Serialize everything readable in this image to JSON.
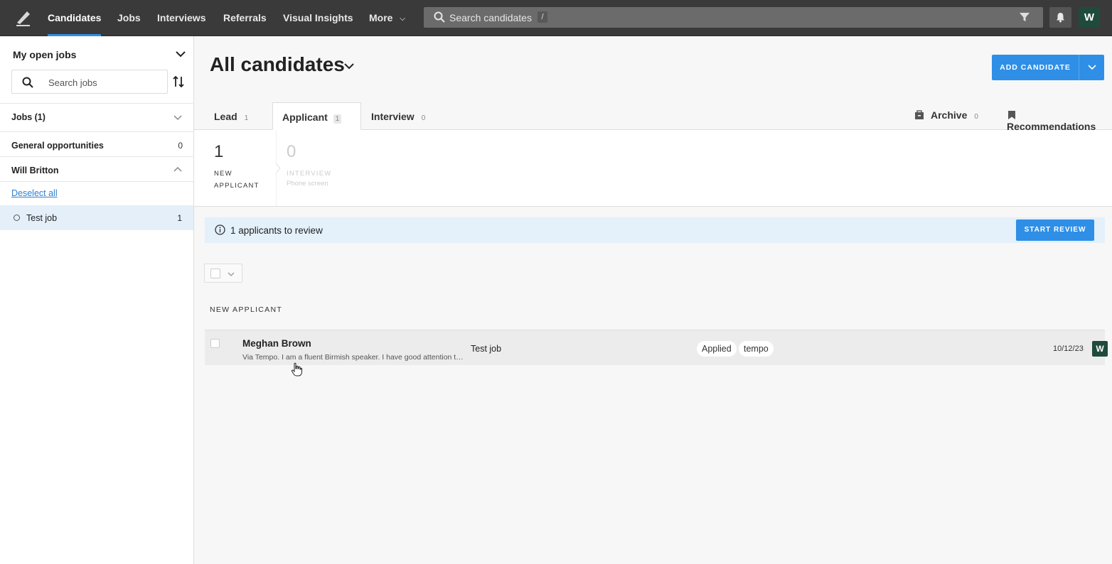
{
  "nav": {
    "items": [
      {
        "label": "Candidates",
        "active": true
      },
      {
        "label": "Jobs"
      },
      {
        "label": "Interviews"
      },
      {
        "label": "Referrals"
      },
      {
        "label": "Visual Insights"
      },
      {
        "label": "More"
      }
    ],
    "search_placeholder": "Search candidates",
    "search_shortcut": "/",
    "avatar_initial": "W"
  },
  "sidebar": {
    "title": "My open jobs",
    "search_placeholder": "Search jobs",
    "jobs_header": "Jobs (1)",
    "general_label": "General opportunities",
    "general_count": "0",
    "owner_label": "Will Britton",
    "deselect_label": "Deselect all",
    "job": {
      "label": "Test job",
      "count": "1"
    }
  },
  "main": {
    "title": "All candidates",
    "add_button": "ADD CANDIDATE",
    "tabs": [
      {
        "label": "Lead",
        "count": "1"
      },
      {
        "label": "Applicant",
        "count": "1"
      },
      {
        "label": "Interview",
        "count": "0"
      }
    ],
    "archive": {
      "label": "Archive",
      "count": "0"
    },
    "recommendations": {
      "label": "Recommendations"
    },
    "stages": [
      {
        "count": "1",
        "label": "NEW APPLICANT",
        "sub": ""
      },
      {
        "count": "0",
        "label": "INTERVIEW",
        "sub": "Phone screen"
      }
    ],
    "review": {
      "text": "1 applicants to review",
      "button": "START REVIEW"
    },
    "section_label": "NEW APPLICANT",
    "candidate": {
      "name": "Meghan Brown",
      "desc": "Via Tempo. I am a fluent Birmish speaker. I have good attention to detail and",
      "job": "Test job",
      "tags": [
        "Applied",
        "tempo"
      ],
      "date": "10/12/23",
      "owner_initial": "W"
    }
  },
  "colors": {
    "accent": "#2f8fe6",
    "topbar": "#3a3a3a",
    "avatar": "#1e4b3c",
    "highlight": "#e4eff9"
  }
}
